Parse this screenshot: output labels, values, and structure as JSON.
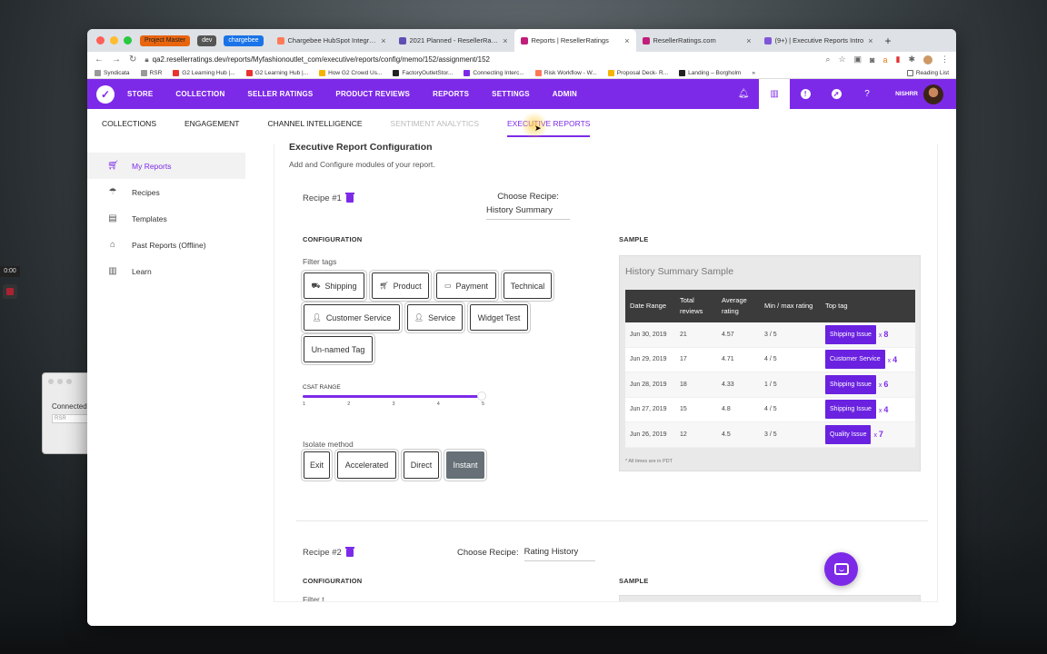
{
  "desktop": {
    "timer": "0:00",
    "mini_window": {
      "text": "Connected.",
      "input": "RSR"
    }
  },
  "tabs": {
    "pills": [
      "Project Master",
      "dev",
      "chargebee"
    ],
    "items": [
      {
        "title": "Chargebee HubSpot Integratio",
        "color": "#ff7a59"
      },
      {
        "title": "2021 Planned - ResellerRatings",
        "color": "#5e4db2"
      },
      {
        "title": "Reports | ResellerRatings",
        "color": "#c01e7a",
        "active": true
      },
      {
        "title": "ResellerRatings.com",
        "color": "#c01e7a"
      },
      {
        "title": "(9+) | Executive Reports Intro",
        "color": "#7f56d9"
      }
    ]
  },
  "address": {
    "url": "qa2.resellerratings.dev/reports/Myfashionoutlet_com/executive/reports/config/memo/152/assignment/152"
  },
  "bookmarks": [
    {
      "label": "Syndicata",
      "color": "#999"
    },
    {
      "label": "RSR",
      "color": "#999"
    },
    {
      "label": "G2 Learning Hub |...",
      "color": "#e8342e"
    },
    {
      "label": "G2 Learning Hub |...",
      "color": "#e8342e"
    },
    {
      "label": "How G2 Crowd Us...",
      "color": "#f5b400"
    },
    {
      "label": "FactoryOutletStor...",
      "color": "#222"
    },
    {
      "label": "Connecting Interc...",
      "color": "#7d2ae8"
    },
    {
      "label": "Risk Workflow - W...",
      "color": "#ff7a59"
    },
    {
      "label": "Proposal Deck- R...",
      "color": "#f5b400"
    },
    {
      "label": "Landing – Borgholm",
      "color": "#222"
    }
  ],
  "bookmarks_more": "»",
  "reading_list": "Reading List",
  "topnav": {
    "items": [
      "STORE",
      "COLLECTION",
      "SELLER RATINGS",
      "PRODUCT REVIEWS",
      "REPORTS",
      "SETTINGS",
      "ADMIN"
    ],
    "user": "NISHRR"
  },
  "subnav": [
    "COLLECTIONS",
    "ENGAGEMENT",
    "CHANNEL INTELLIGENCE",
    "SENTIMENT ANALYTICS",
    "EXECUTIVE REPORTS"
  ],
  "sidebar": [
    "My Reports",
    "Recipes",
    "Templates",
    "Past Reports (Offline)",
    "Learn"
  ],
  "config": {
    "title": "Executive Report Configuration",
    "subtitle": "Add and Configure modules of your report.",
    "recipe1": {
      "label": "Recipe #1",
      "choose_label": "Choose Recipe:",
      "choose_value": "History Summary",
      "config_label": "CONFIGURATION",
      "sample_label": "SAMPLE",
      "filter_label": "Filter tags",
      "tags": [
        "Shipping",
        "Product",
        "Payment",
        "Technical",
        "Customer Service",
        "Service",
        "Widget Test",
        "Un-named Tag"
      ],
      "csat_label": "CSAT RANGE",
      "csat_ticks": [
        "1",
        "2",
        "3",
        "4",
        "5"
      ],
      "isolate_label": "Isolate method",
      "isolate_options": [
        "Exit",
        "Accelerated",
        "Direct",
        "Instant"
      ]
    },
    "recipe2": {
      "label": "Recipe #2",
      "choose_label": "Choose Recipe:",
      "choose_value": "Rating History",
      "config_label": "CONFIGURATION",
      "sample_label": "SAMPLE",
      "filter_label": "Filter t..."
    }
  },
  "sample": {
    "title": "History Summary Sample",
    "headers": [
      "Date Range",
      "Total reviews",
      "Average rating",
      "Min / max rating",
      "Top tag"
    ],
    "rows": [
      [
        "Jun 30, 2019",
        "21",
        "4.57",
        "3 / 5",
        "Shipping Issue",
        "8"
      ],
      [
        "Jun 29, 2019",
        "17",
        "4.71",
        "4 / 5",
        "Customer Service",
        "4"
      ],
      [
        "Jun 28, 2019",
        "18",
        "4.33",
        "1 / 5",
        "Shipping Issue",
        "6"
      ],
      [
        "Jun 27, 2019",
        "15",
        "4.8",
        "4 / 5",
        "Shipping Issue",
        "4"
      ],
      [
        "Jun 26, 2019",
        "12",
        "4.5",
        "3 / 5",
        "Quality Issue",
        "7"
      ]
    ],
    "footnote": "* All times are in PDT"
  },
  "colors": {
    "brand": "#7d2ae8",
    "selected_button": "#667076"
  }
}
